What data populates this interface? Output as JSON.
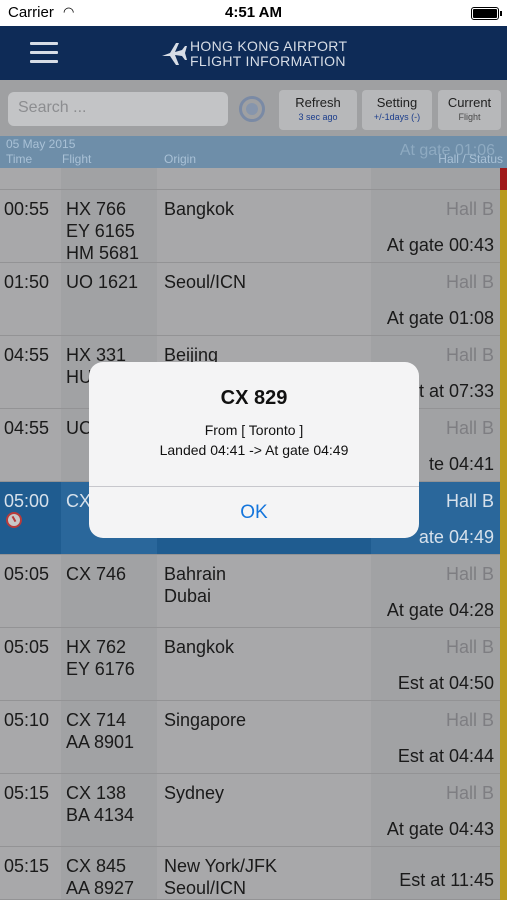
{
  "status_bar": {
    "carrier": "Carrier",
    "time": "4:51 AM"
  },
  "nav": {
    "title_line1": "HONG KONG AIRPORT",
    "title_line2": "FLIGHT INFORMATION"
  },
  "toolbar": {
    "search_placeholder": "Search ...",
    "refresh_label": "Refresh",
    "refresh_sub": "3 sec ago",
    "setting_label": "Setting",
    "setting_sub": "+/-1days (-)",
    "current_label": "Current",
    "current_sub": "Flight"
  },
  "table": {
    "date": "05 May 2015",
    "ghost_status": "At gate 01:06",
    "headers": {
      "time": "Time",
      "flight": "Flight",
      "origin": "Origin",
      "status": "Hall / Status"
    },
    "rows": [
      {
        "time": "00:55",
        "flights": "HX 766\nEY 6165\nHM 5681",
        "origin": "Bangkok",
        "hall": "Hall B",
        "status": "At gate 00:43"
      },
      {
        "time": "01:50",
        "flights": "UO 1621",
        "origin": "Seoul/ICN",
        "hall": "Hall B",
        "status": "At gate 01:08"
      },
      {
        "time": "04:55",
        "flights": "HX 331\nHU",
        "origin": "Beijing",
        "hall": "Hall B",
        "status": "st at 07:33"
      },
      {
        "time": "04:55",
        "flights": "UC",
        "origin": "",
        "hall": "Hall B",
        "status": "te 04:41"
      },
      {
        "time": "05:00",
        "flights": "CX",
        "origin": "",
        "hall": "Hall B",
        "status": "ate 04:49"
      },
      {
        "time": "05:05",
        "flights": "CX 746",
        "origin": "Bahrain\nDubai",
        "hall": "Hall B",
        "status": "At gate 04:28"
      },
      {
        "time": "05:05",
        "flights": "HX 762\nEY 6176",
        "origin": "Bangkok",
        "hall": "Hall B",
        "status": "Est at 04:50"
      },
      {
        "time": "05:10",
        "flights": "CX 714\nAA 8901",
        "origin": "Singapore",
        "hall": "Hall B",
        "status": "Est at 04:44"
      },
      {
        "time": "05:15",
        "flights": "CX 138\nBA 4134",
        "origin": "Sydney",
        "hall": "Hall B",
        "status": "At gate 04:43"
      },
      {
        "time": "05:15",
        "flights": "CX 845\nAA 8927",
        "origin": "New York/JFK\nSeoul/ICN",
        "hall": "",
        "status": "Est at 11:45"
      }
    ]
  },
  "alert": {
    "title": "CX 829",
    "line1": "From [ Toronto ]",
    "line2": "Landed 04:41 -> At gate 04:49",
    "ok": "OK"
  }
}
